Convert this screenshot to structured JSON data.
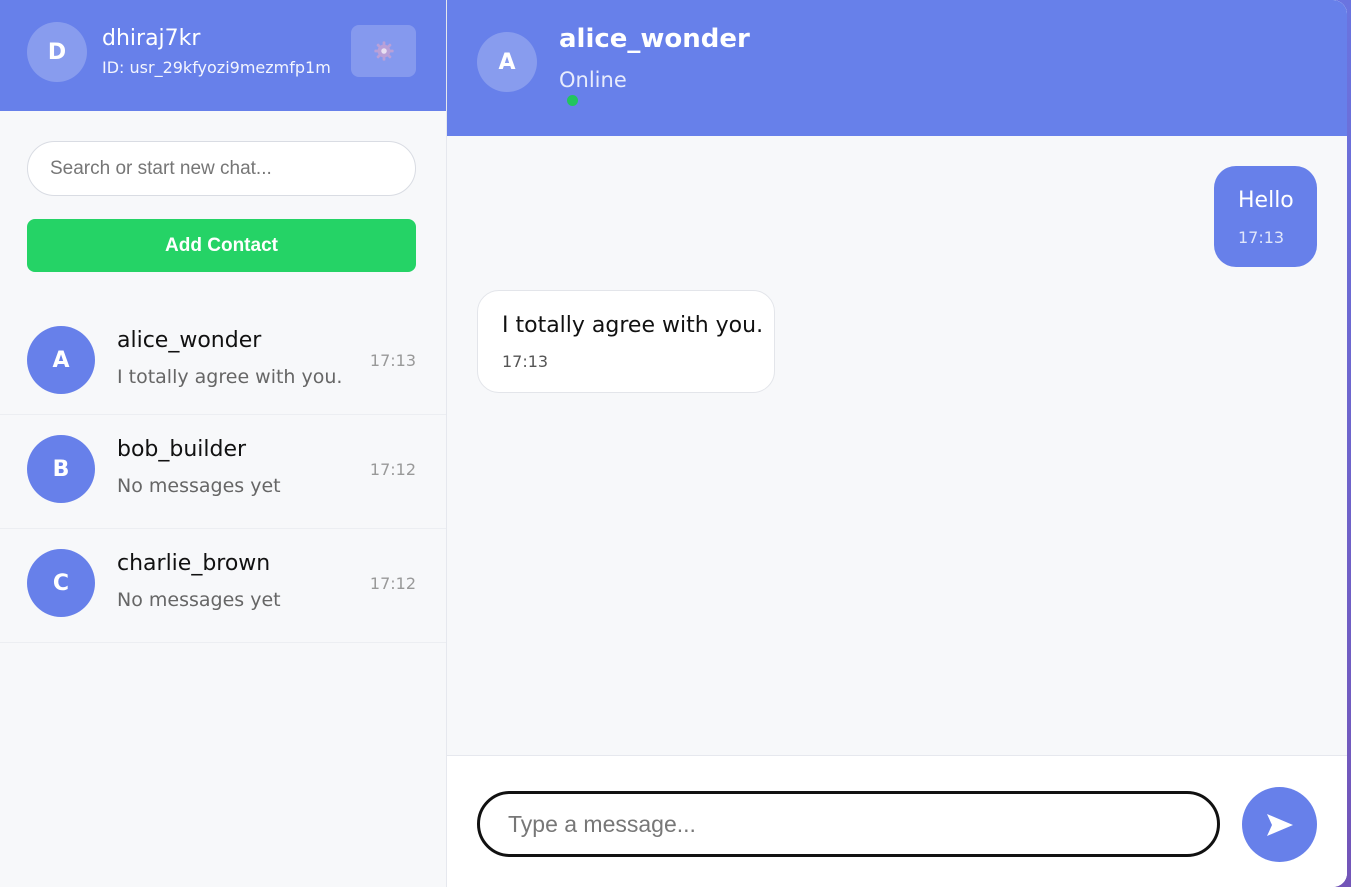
{
  "me": {
    "initial": "D",
    "username": "dhiraj7kr",
    "id_text": "ID: usr_29kfyozi9mezmfp1m"
  },
  "search": {
    "placeholder": "Search or start new chat..."
  },
  "add_contact_label": "Add Contact",
  "contacts": [
    {
      "initial": "A",
      "name": "alice_wonder",
      "preview": "I totally agree with you.",
      "time": "17:13"
    },
    {
      "initial": "B",
      "name": "bob_builder",
      "preview": "No messages yet",
      "time": "17:12"
    },
    {
      "initial": "C",
      "name": "charlie_brown",
      "preview": "No messages yet",
      "time": "17:12"
    }
  ],
  "chat": {
    "peer_initial": "A",
    "peer_name": "alice_wonder",
    "peer_status": "Online",
    "messages": [
      {
        "direction": "out",
        "text": "Hello",
        "time": "17:13"
      },
      {
        "direction": "in",
        "text": "I totally agree with you.",
        "time": "17:13"
      }
    ]
  },
  "composer": {
    "placeholder": "Type a message..."
  },
  "icons": {
    "settings": "gear-icon",
    "send": "send-icon"
  },
  "colors": {
    "brand": "#6780ea",
    "accent_green": "#25d366",
    "online": "#22c55e"
  }
}
